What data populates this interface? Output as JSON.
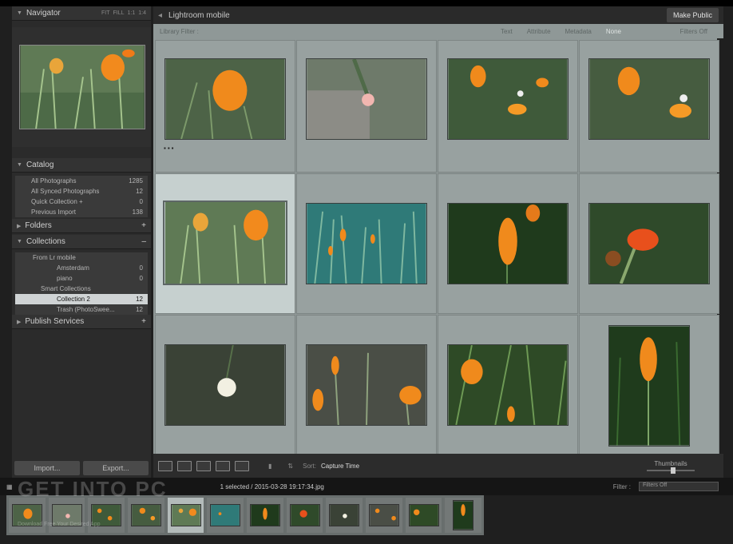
{
  "navigator": {
    "title": "Navigator",
    "zoom_options": [
      "FIT",
      "FILL",
      "1:1",
      "1:4"
    ]
  },
  "catalog": {
    "title": "Catalog",
    "items": [
      {
        "label": "All Photographs",
        "count": "1285"
      },
      {
        "label": "All Synced Photographs",
        "count": "12"
      },
      {
        "label": "Quick Collection +",
        "count": "0"
      },
      {
        "label": "Previous Import",
        "count": "138"
      }
    ]
  },
  "folders": {
    "title": "Folders"
  },
  "collections": {
    "title": "Collections",
    "items": [
      {
        "label": "From Lr mobile",
        "count": "",
        "indent": 1
      },
      {
        "label": "Amsterdam",
        "count": "0",
        "indent": 2
      },
      {
        "label": "piano",
        "count": "0",
        "indent": 2
      },
      {
        "label": "Smart Collections",
        "count": "",
        "indent": 1
      },
      {
        "label": "Collection 2",
        "count": "12",
        "indent": 2,
        "selected": true
      },
      {
        "label": "Trash (PhotoSwee...",
        "count": "12",
        "indent": 2
      }
    ]
  },
  "publish": {
    "title": "Publish Services"
  },
  "buttons": {
    "import": "Import...",
    "export": "Export..."
  },
  "header": {
    "title": "Lightroom mobile",
    "make_public": "Make Public"
  },
  "filterbar": {
    "label": "Library Filter :",
    "options": [
      "Text",
      "Attribute",
      "Metadata",
      "None"
    ],
    "right": "Filters Off"
  },
  "toolbar": {
    "sort_label": "Sort:",
    "sort_value": "Capture Time",
    "thumbnails_label": "Thumbnails"
  },
  "filmstrip": {
    "path": "1 selected / 2015-03-28 19:17:34.jpg",
    "filter_label": "Filter :",
    "filter_value": "Filters Off"
  },
  "watermark": {
    "text": "GET INTO PC",
    "subtext": "Download Free Your Desired App"
  },
  "colors": {
    "grid_bg": "#8f9897",
    "selected_cell": "#c6d0cf",
    "panel_bg": "#2b2b2b",
    "accent_orange": "#f08a1c"
  }
}
